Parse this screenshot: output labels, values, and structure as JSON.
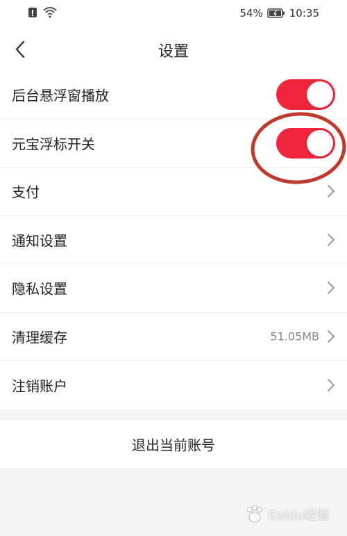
{
  "status_bar": {
    "battery_percent": "54%",
    "time": "10:35",
    "icons": [
      "alert-icon",
      "wifi-icon",
      "battery-icon"
    ]
  },
  "header": {
    "title": "设置",
    "back_icon": "chevron-left-icon"
  },
  "settings": {
    "items": [
      {
        "label": "后台悬浮窗播放",
        "control": "toggle",
        "on": true
      },
      {
        "label": "元宝浮标开关",
        "control": "toggle",
        "on": true
      },
      {
        "label": "支付",
        "control": "chevron"
      },
      {
        "label": "通知设置",
        "control": "chevron"
      },
      {
        "label": "隐私设置",
        "control": "chevron"
      },
      {
        "label": "清理缓存",
        "control": "chevron",
        "value": "51.05MB"
      },
      {
        "label": "注销账户",
        "control": "chevron"
      }
    ]
  },
  "logout": {
    "label": "退出当前账号"
  },
  "colors": {
    "toggle_on": "#f0243a",
    "annotation": "#c0392b",
    "background": "#f4f4f4"
  },
  "watermark": {
    "text": "Baidu经验"
  }
}
